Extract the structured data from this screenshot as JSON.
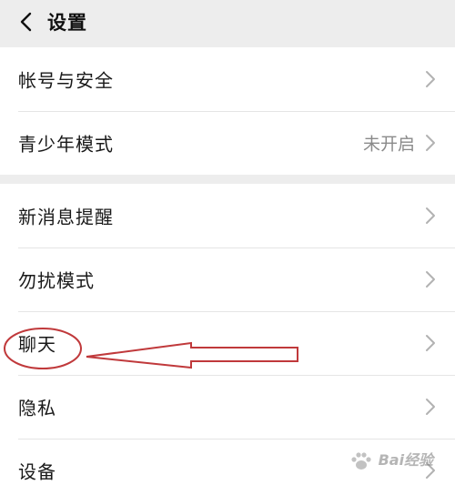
{
  "header": {
    "title": "设置",
    "back_icon": "chevron-left-icon"
  },
  "groups": [
    {
      "items": [
        {
          "label": "帐号与安全",
          "value": ""
        },
        {
          "label": "青少年模式",
          "value": "未开启"
        }
      ]
    },
    {
      "items": [
        {
          "label": "新消息提醒",
          "value": ""
        },
        {
          "label": "勿扰模式",
          "value": ""
        },
        {
          "label": "聊天",
          "value": ""
        },
        {
          "label": "隐私",
          "value": ""
        },
        {
          "label": "设备",
          "value": ""
        }
      ]
    }
  ],
  "annotation": {
    "color": "#c0393b",
    "target": "聊天"
  },
  "watermark": {
    "text": "Bai经验"
  },
  "colors": {
    "background": "#ededed",
    "card": "#ffffff",
    "text": "#191919",
    "secondary_text": "#8a8a8a",
    "chevron": "#b2b2b2"
  }
}
